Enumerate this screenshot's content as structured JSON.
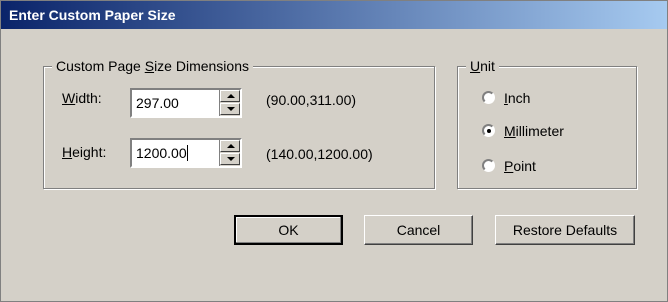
{
  "window": {
    "title": "Enter Custom Paper Size"
  },
  "dimensions_group": {
    "legend_pre": "Custom Page ",
    "legend_u": "S",
    "legend_post": "ize Dimensions",
    "width": {
      "label_u": "W",
      "label_rest": "idth:",
      "value": "297.00",
      "range": "(90.00,311.00)"
    },
    "height": {
      "label_u": "H",
      "label_rest": "eight:",
      "value": "1200.00",
      "range": "(140.00,1200.00)"
    }
  },
  "unit_group": {
    "legend_u": "U",
    "legend_rest": "nit",
    "options": [
      {
        "u": "I",
        "rest": "nch",
        "selected": false
      },
      {
        "u": "M",
        "rest": "illimeter",
        "selected": true
      },
      {
        "u": "P",
        "rest": "oint",
        "selected": false
      }
    ]
  },
  "buttons": {
    "ok": "OK",
    "cancel": "Cancel",
    "restore": "Restore Defaults"
  }
}
